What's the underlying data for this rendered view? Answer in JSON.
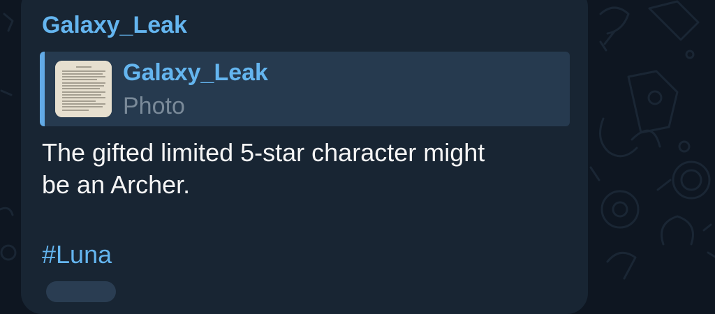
{
  "message": {
    "sender": "Galaxy_Leak",
    "reply": {
      "author": "Galaxy_Leak",
      "media_type": "Photo",
      "thumbnail_icon": "document-photo-thumbnail"
    },
    "text_lines": [
      "The gifted limited 5-star character might",
      "be an Archer."
    ],
    "hashtag": "#Luna"
  },
  "colors": {
    "background": "#0e1621",
    "bubble": "#182533",
    "accent": "#64b5ef",
    "reply_bg": "#263a4f",
    "text": "#f5f5f5",
    "muted": "#7a8a99"
  }
}
